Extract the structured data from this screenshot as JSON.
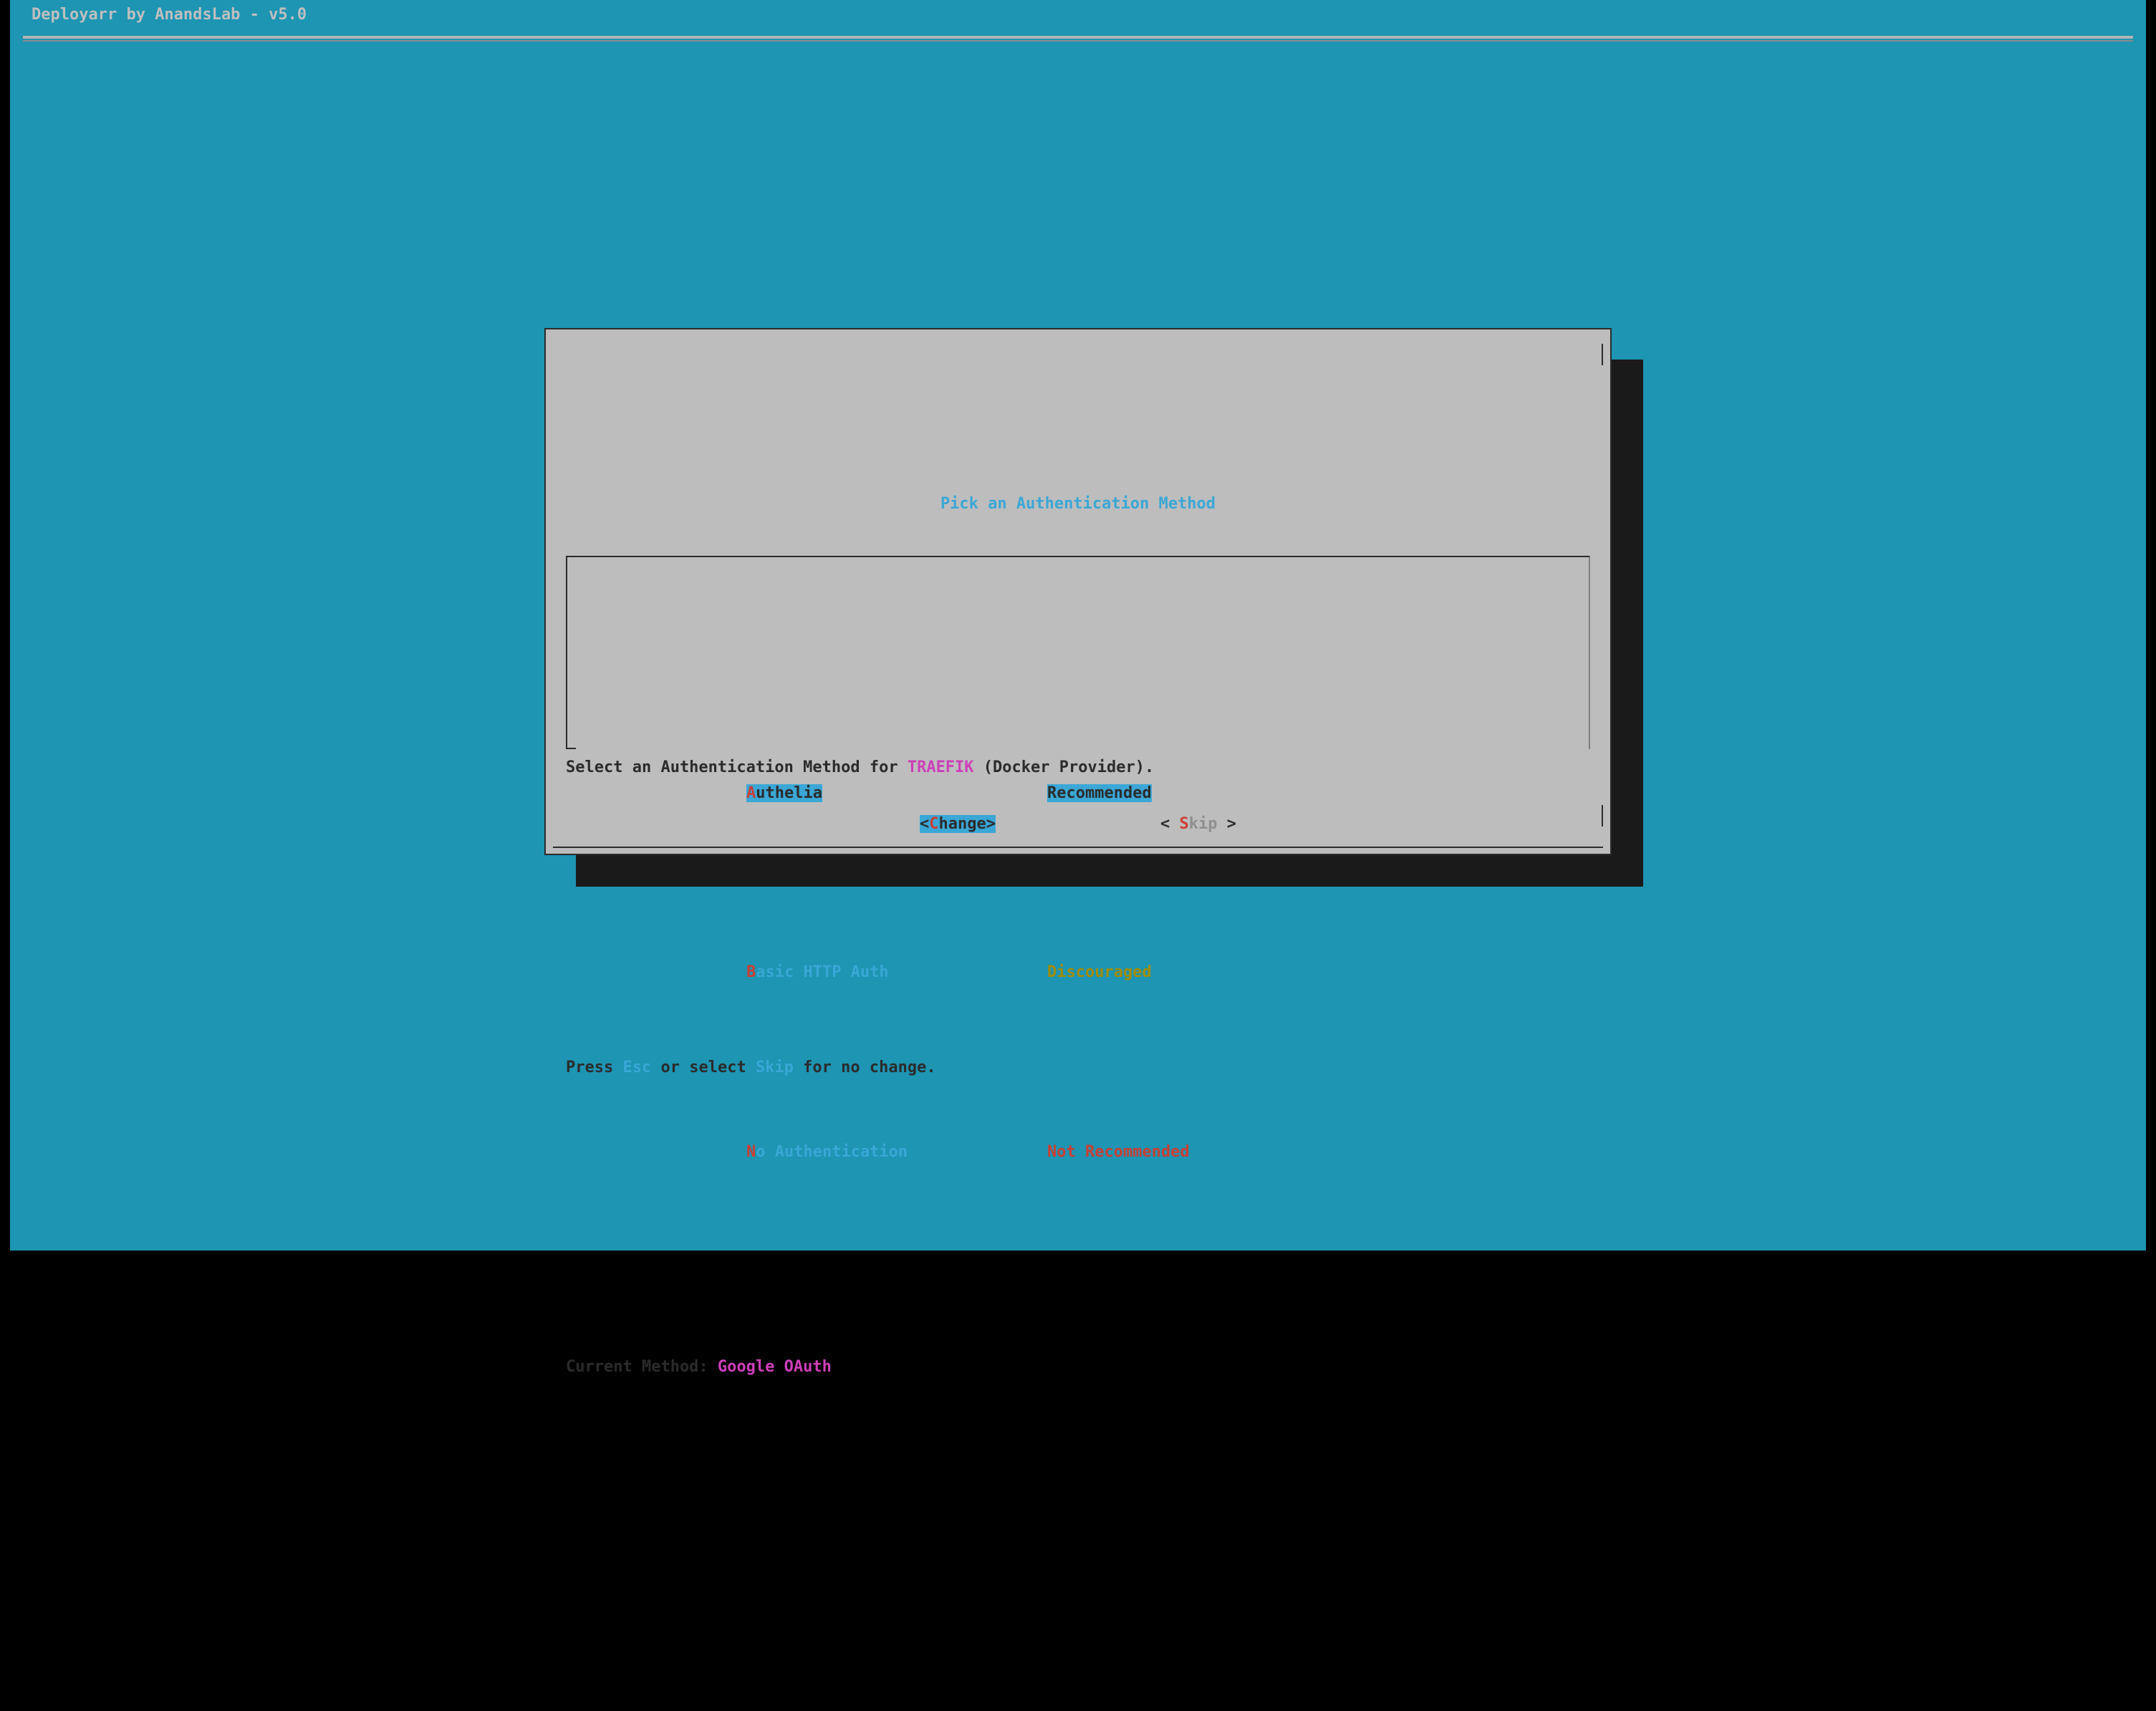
{
  "app": {
    "title": "Deployarr by AnandsLab - v5.0"
  },
  "dialog": {
    "title": "Pick an Authentication Method",
    "line1_pre": "Select an Authentication Method for ",
    "line1_target": "TRAEFIK",
    "line1_post": " (Docker Provider).",
    "line2_pre": "Press ",
    "line2_esc": "Esc",
    "line2_mid": " or select ",
    "line2_skip": "Skip",
    "line2_post": " for no change.",
    "line3_pre": "Current Method: ",
    "line3_method": "Google OAuth",
    "menu": [
      {
        "hot": "A",
        "rest": "uthelia",
        "desc": "Recommended",
        "selected": true,
        "desc_style": "sel"
      },
      {
        "hot": "B",
        "rest": "asic HTTP Auth",
        "desc": "Discouraged",
        "selected": false,
        "desc_style": "yellow"
      },
      {
        "hot": "N",
        "rest": "o Authentication",
        "desc": "Not Recommended",
        "selected": false,
        "desc_style": "red"
      }
    ],
    "buttons": {
      "change": {
        "open": "<",
        "hot": "C",
        "rest": "hange",
        "close": ">",
        "selected": true
      },
      "skip": {
        "open": "< ",
        "hot": "S",
        "rest": "kip",
        "close": " >",
        "selected": false
      }
    }
  }
}
